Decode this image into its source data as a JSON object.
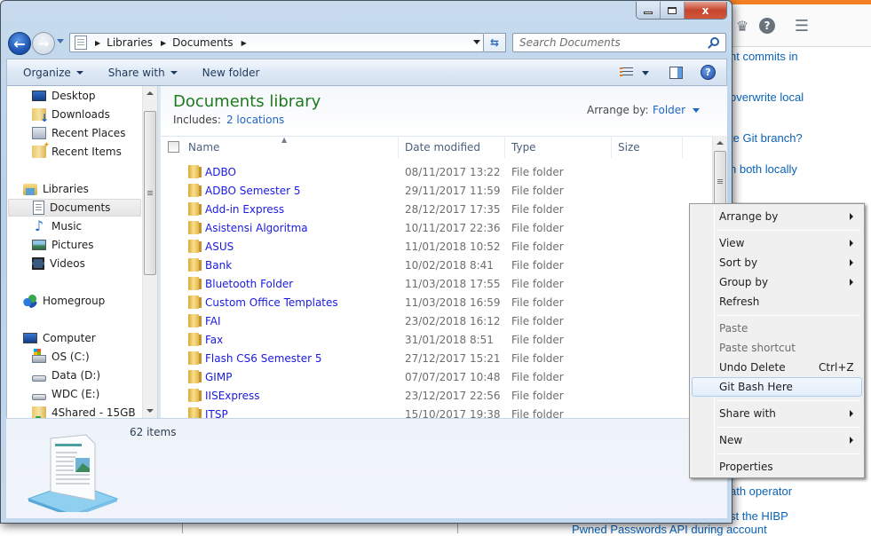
{
  "background_page": {
    "links": [
      "nt commits in",
      "overwrite local",
      "te Git branch?",
      "h both locally",
      "ath operator",
      "st the HIBP",
      "Pwned Passwords API during account"
    ],
    "header_icons": [
      "trophy-icon",
      "help-icon",
      "inbox-icon"
    ]
  },
  "window": {
    "caption_buttons": {
      "minimize": "minimize",
      "maximize": "maximize",
      "close": "x"
    },
    "address": {
      "breadcrumbs": [
        "Libraries",
        "Documents"
      ]
    },
    "search": {
      "placeholder": "Search Documents"
    },
    "command_bar": {
      "organize": "Organize",
      "share_with": "Share with",
      "new_folder": "New folder"
    },
    "nav_pane": {
      "favorites": [
        {
          "label": "Desktop",
          "icon": "desktop-icon"
        },
        {
          "label": "Downloads",
          "icon": "downloads-icon"
        },
        {
          "label": "Recent Places",
          "icon": "recent-places-icon"
        },
        {
          "label": "Recent Items",
          "icon": "recent-items-icon"
        }
      ],
      "libraries": {
        "label": "Libraries",
        "items": [
          {
            "label": "Documents",
            "selected": true
          },
          {
            "label": "Music"
          },
          {
            "label": "Pictures"
          },
          {
            "label": "Videos"
          }
        ]
      },
      "homegroup": "Homegroup",
      "computer": {
        "label": "Computer",
        "drives": [
          "OS (C:)",
          "Data (D:)",
          "WDC (E:)",
          "4Shared - 15GB"
        ]
      }
    },
    "library": {
      "title": "Documents library",
      "includes_label": "Includes:",
      "includes_link": "2 locations",
      "arrange_by_label": "Arrange by:",
      "arrange_by_value": "Folder"
    },
    "columns": [
      "Name",
      "Date modified",
      "Type",
      "Size"
    ],
    "rows": [
      {
        "name": "ADBO",
        "date": "08/11/2017 13:22",
        "type": "File folder"
      },
      {
        "name": "ADBO Semester 5",
        "date": "29/11/2017 11:59",
        "type": "File folder"
      },
      {
        "name": "Add-in Express",
        "date": "28/12/2017 17:35",
        "type": "File folder"
      },
      {
        "name": "Asistensi Algoritma",
        "date": "10/11/2017 22:36",
        "type": "File folder"
      },
      {
        "name": "ASUS",
        "date": "11/01/2018 10:52",
        "type": "File folder"
      },
      {
        "name": "Bank",
        "date": "10/02/2018 8:41",
        "type": "File folder"
      },
      {
        "name": "Bluetooth Folder",
        "date": "11/03/2018 17:55",
        "type": "File folder"
      },
      {
        "name": "Custom Office Templates",
        "date": "11/03/2018 16:59",
        "type": "File folder"
      },
      {
        "name": "FAI",
        "date": "23/02/2018 16:12",
        "type": "File folder"
      },
      {
        "name": "Fax",
        "date": "31/01/2018 8:51",
        "type": "File folder"
      },
      {
        "name": "Flash CS6 Semester 5",
        "date": "27/12/2017 15:21",
        "type": "File folder"
      },
      {
        "name": "GIMP",
        "date": "07/07/2017 10:48",
        "type": "File folder"
      },
      {
        "name": "IISExpress",
        "date": "23/12/2017 22:56",
        "type": "File folder"
      },
      {
        "name": "ITSP",
        "date": "15/10/2017 19:38",
        "type": "File folder"
      }
    ],
    "details": {
      "items_count": "62 items"
    }
  },
  "context_menu": {
    "items": [
      {
        "label": "Arrange by",
        "submenu": true
      },
      {
        "label": "View",
        "submenu": true
      },
      {
        "label": "Sort by",
        "submenu": true
      },
      {
        "label": "Group by",
        "submenu": true
      },
      {
        "label": "Refresh"
      },
      {
        "label": "Paste",
        "disabled": true
      },
      {
        "label": "Paste shortcut",
        "disabled": true
      },
      {
        "label": "Undo Delete",
        "shortcut": "Ctrl+Z"
      },
      {
        "label": "Git Bash Here",
        "highlighted": true
      },
      {
        "label": "Share with",
        "submenu": true
      },
      {
        "label": "New",
        "submenu": true
      },
      {
        "label": "Properties"
      }
    ]
  }
}
